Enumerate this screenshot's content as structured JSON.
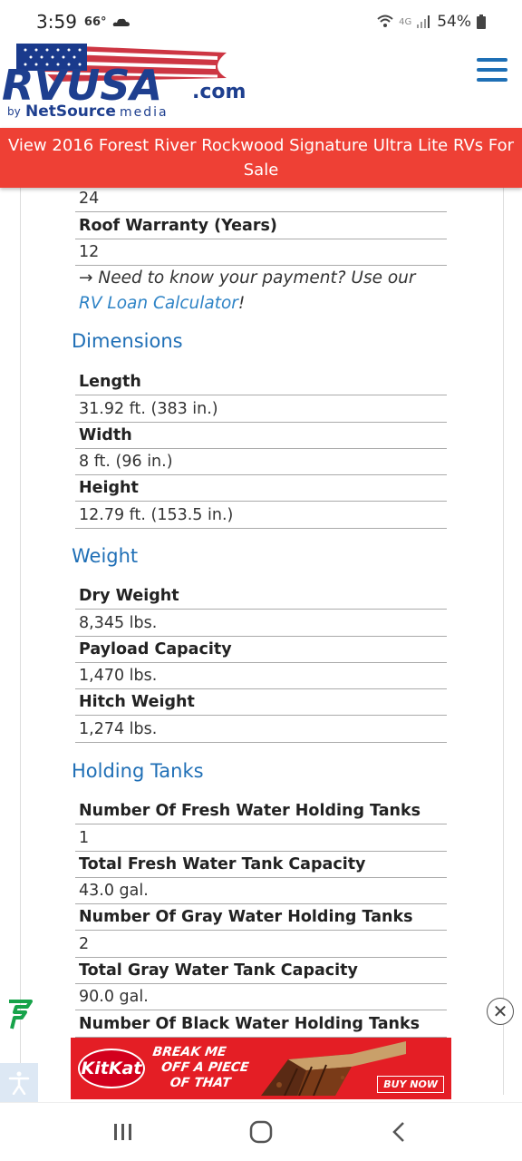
{
  "status_bar": {
    "time": "3:59",
    "temp": "66°",
    "battery": "54%",
    "network": "4G"
  },
  "header": {
    "logo_text_main": "RVUSA",
    "logo_text_domain": ".com",
    "logo_by": "by",
    "logo_company": "NetSource",
    "logo_company_suffix": "media"
  },
  "banner": {
    "title": "View 2016 Forest River Rockwood Signature Ultra Lite RVs For Sale"
  },
  "warranty": {
    "top_value": "24",
    "roof_label": "Roof Warranty (Years)",
    "roof_value": "12",
    "note_prefix": "→ Need to know your payment? Use our ",
    "note_link": "RV Loan Calculator",
    "note_suffix": "!"
  },
  "dimensions": {
    "title": "Dimensions",
    "rows": [
      {
        "label": "Length",
        "value": "31.92 ft. (383 in.)"
      },
      {
        "label": "Width",
        "value": "8 ft. (96 in.)"
      },
      {
        "label": "Height",
        "value": "12.79 ft. (153.5 in.)"
      }
    ]
  },
  "weight": {
    "title": "Weight",
    "rows": [
      {
        "label": "Dry Weight",
        "value": "8,345 lbs."
      },
      {
        "label": "Payload Capacity",
        "value": "1,470 lbs."
      },
      {
        "label": "Hitch Weight",
        "value": "1,274 lbs."
      }
    ]
  },
  "holding_tanks": {
    "title": "Holding Tanks",
    "rows": [
      {
        "label": "Number Of Fresh Water Holding Tanks",
        "value": "1"
      },
      {
        "label": "Total Fresh Water Tank Capacity",
        "value": "43.0 gal."
      },
      {
        "label": "Number Of Gray Water Holding Tanks",
        "value": "2"
      },
      {
        "label": "Total Gray Water Tank Capacity",
        "value": "90.0 gal."
      },
      {
        "label": "Number Of Black Water Holding Tanks",
        "value": ""
      }
    ]
  },
  "ad": {
    "brand": "KitKat",
    "tagline_1": "BREAK ME",
    "tagline_2": "OFF A PIECE",
    "tagline_3": "OF THAT",
    "cta": "BUY NOW"
  },
  "colors": {
    "banner": "#ee4035",
    "section_title": "#1f6fb6",
    "link": "#2e83c6",
    "menu": "#1e6fb5"
  },
  "icons": {
    "menu": "hamburger-icon",
    "close": "close-icon",
    "accessibility": "accessibility-icon",
    "freespee": "freespee-icon"
  }
}
